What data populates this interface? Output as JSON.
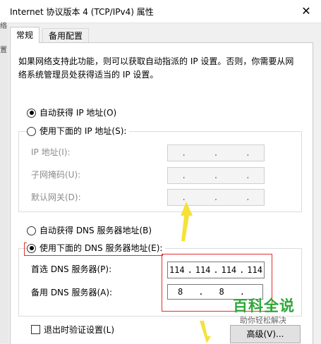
{
  "window": {
    "title": "Internet 协议版本 4 (TCP/IPv4) 属性",
    "close_glyph": "✕"
  },
  "left_strip": {
    "chars": [
      "络",
      "置"
    ]
  },
  "tabs": [
    {
      "label": "常规"
    },
    {
      "label": "备用配置"
    }
  ],
  "description": "如果网络支持此功能，则可以获取自动指派的 IP 设置。否则，你需要从网络系统管理员处获得适当的 IP 设置。",
  "ip_section": {
    "auto_label": "自动获得 IP 地址(O)",
    "manual_label": "使用下面的 IP 地址(S):",
    "fields": [
      {
        "label": "IP 地址(I):"
      },
      {
        "label": "子网掩码(U):"
      },
      {
        "label": "默认网关(D):"
      }
    ],
    "empty_sep": "."
  },
  "dns_section": {
    "auto_label": "自动获得 DNS 服务器地址(B)",
    "manual_label": "使用下面的 DNS 服务器地址(E):",
    "preferred_label": "首选 DNS 服务器(P):",
    "preferred_octets": [
      "114",
      ".",
      "114",
      ".",
      "114",
      ".",
      "114"
    ],
    "alternate_label": "备用 DNS 服务器(A):",
    "alternate_octets": [
      "8",
      ".",
      "8",
      "."
    ]
  },
  "validate_label": "退出时验证设置(L)",
  "advanced_label": "高级(V)...",
  "watermark": {
    "title": "百科全说",
    "subtitle": "助你轻松解决"
  },
  "colors": {
    "annotation_red": "#e03030",
    "arrow_yellow": "#f5e13a",
    "watermark_green": "#2fa83a"
  }
}
